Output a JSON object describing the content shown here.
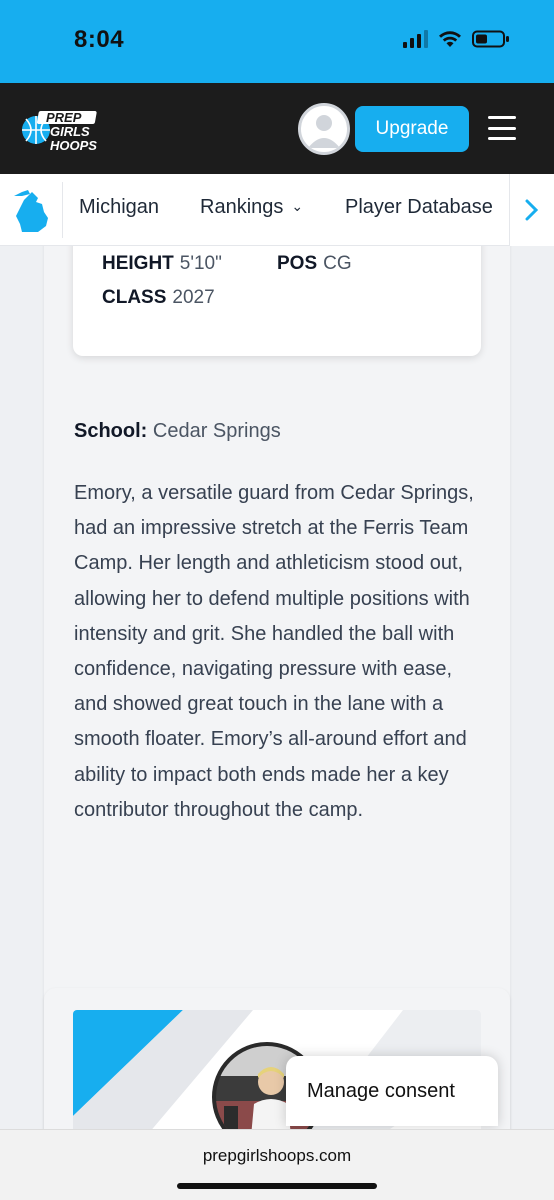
{
  "status_bar": {
    "time": "8:04"
  },
  "header": {
    "logo": {
      "line1": "PREP",
      "line2": "GIRLS",
      "line3": "HOOPS"
    },
    "upgrade_label": "Upgrade"
  },
  "nav": {
    "items": [
      {
        "label": "Michigan"
      },
      {
        "label": "Rankings"
      },
      {
        "label": "Player Database"
      }
    ]
  },
  "player": {
    "height_label": "HEIGHT",
    "height_value": "5'10\"",
    "pos_label": "POS",
    "pos_value": "CG",
    "class_label": "CLASS",
    "class_value": "2027",
    "school_label": "School:",
    "school_value": "Cedar Springs",
    "bio": "Emory, a versatile guard from Cedar Springs, had an impressive stretch at the Ferris Team Camp. Her length and athleticism stood out, allowing her to defend multiple positions with intensity and grit. She handled the ball with confidence, navigating pressure with ease, and showed great touch in the lane with a smooth floater. Emory’s all-around effort and ability to impact both ends made her a key contributor throughout the camp."
  },
  "consent": {
    "label": "Manage consent"
  },
  "browser": {
    "url": "prepgirlshoops.com"
  },
  "colors": {
    "accent": "#17aeef",
    "header_bg": "#1c1c1c"
  }
}
